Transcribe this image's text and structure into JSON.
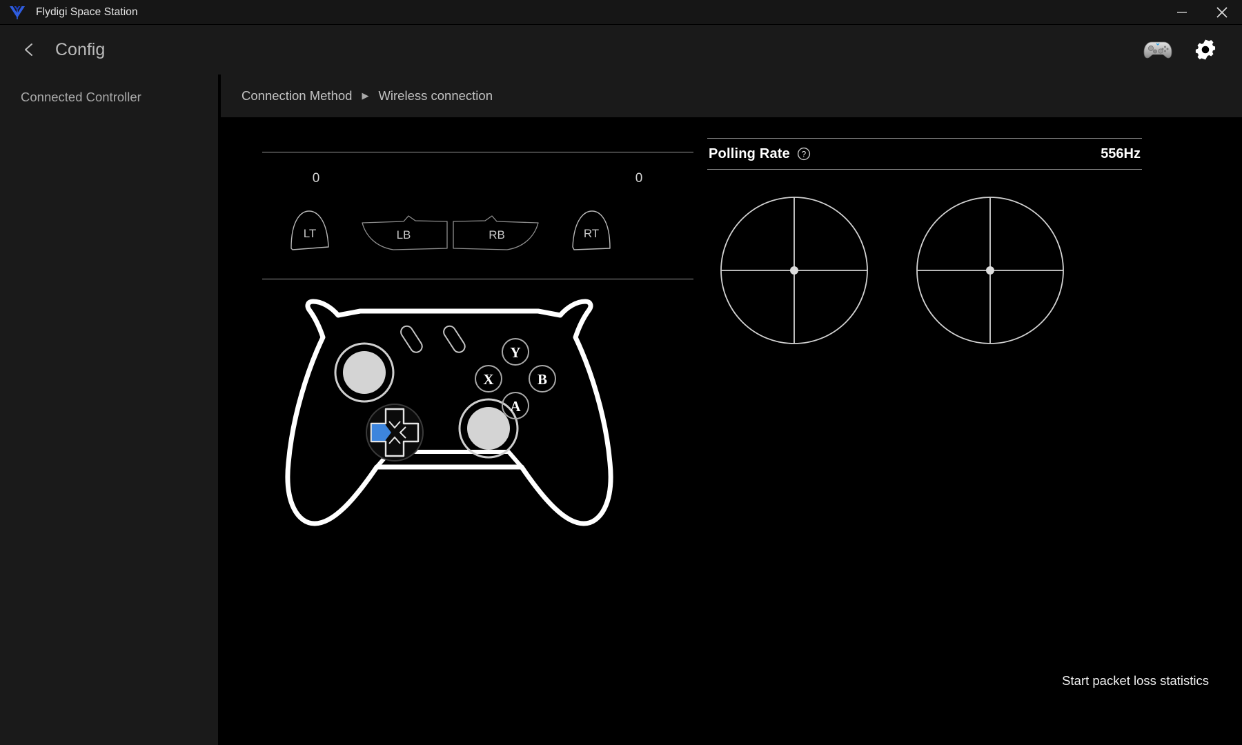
{
  "window": {
    "app_title": "Flydigi Space Station",
    "logo_icon": "flydigi-logo-icon",
    "logo_color": "#2f5de0",
    "minimize_label": "—",
    "close_label": "✕"
  },
  "header": {
    "back_icon": "chevron-left-icon",
    "page_title": "Config",
    "gamepad_icon": "gamepad-icon",
    "settings_icon": "gear-icon"
  },
  "sidebar": {
    "heading": "Connected Controller",
    "items": []
  },
  "breadcrumb": {
    "root": "Connection Method",
    "separator": "▶",
    "current": "Wireless connection"
  },
  "triggers": {
    "left": {
      "value": "0",
      "label": "LT"
    },
    "right": {
      "value": "0",
      "label": "RT"
    },
    "left_bumper": {
      "label": "LB"
    },
    "right_bumper": {
      "label": "RB"
    }
  },
  "controller": {
    "buttons": {
      "y": "Y",
      "x": "X",
      "b": "B",
      "a": "A"
    },
    "dpad_active_direction": "left",
    "dpad_active_color": "#3d85dd",
    "stick_fill_color": "#d4d4d4",
    "body_stroke_color": "#ffffff"
  },
  "polling": {
    "label": "Polling Rate",
    "help_icon": "question-circle-icon",
    "value": "556Hz"
  },
  "sticks": {
    "left": {
      "name": "left-stick-indicator",
      "x": 0,
      "y": 0
    },
    "right": {
      "name": "right-stick-indicator",
      "x": 0,
      "y": 0
    }
  },
  "footer": {
    "packet_loss_link": "Start packet loss statistics"
  }
}
